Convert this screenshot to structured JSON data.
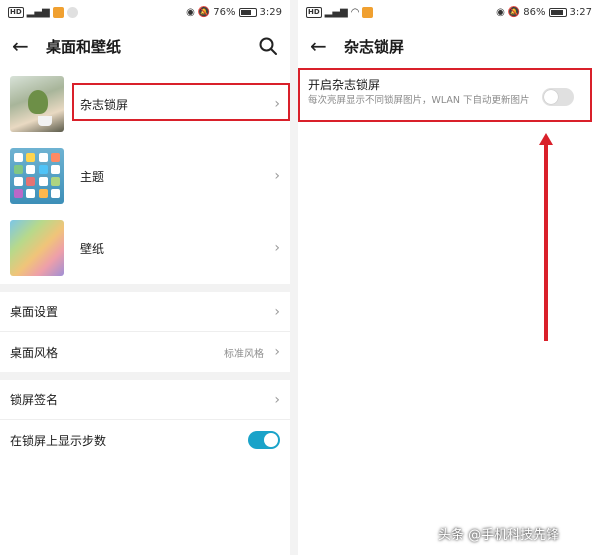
{
  "left": {
    "status": {
      "battery": "76%",
      "time": "3:29",
      "battery_level": 0.76
    },
    "title": "桌面和壁纸",
    "wallpapers": [
      {
        "label": "杂志锁屏"
      },
      {
        "label": "主题"
      },
      {
        "label": "壁纸"
      }
    ],
    "desktop": {
      "settings_label": "桌面设置",
      "style_label": "桌面风格",
      "style_value": "标准风格"
    },
    "lock": {
      "signature_label": "锁屏签名",
      "steps_label": "在锁屏上显示步数",
      "steps_on": true
    }
  },
  "right": {
    "status": {
      "battery": "86%",
      "time": "3:27",
      "battery_level": 0.86
    },
    "title": "杂志锁屏",
    "toggle_title": "开启杂志锁屏",
    "toggle_desc": "每次亮屏显示不同锁屏图片，WLAN 下自动更新图片",
    "toggle_on": false
  },
  "watermark": "头条 @手机科技先锋",
  "colors": {
    "highlight": "#d9202a",
    "toggle_on": "#1aa3c9"
  }
}
